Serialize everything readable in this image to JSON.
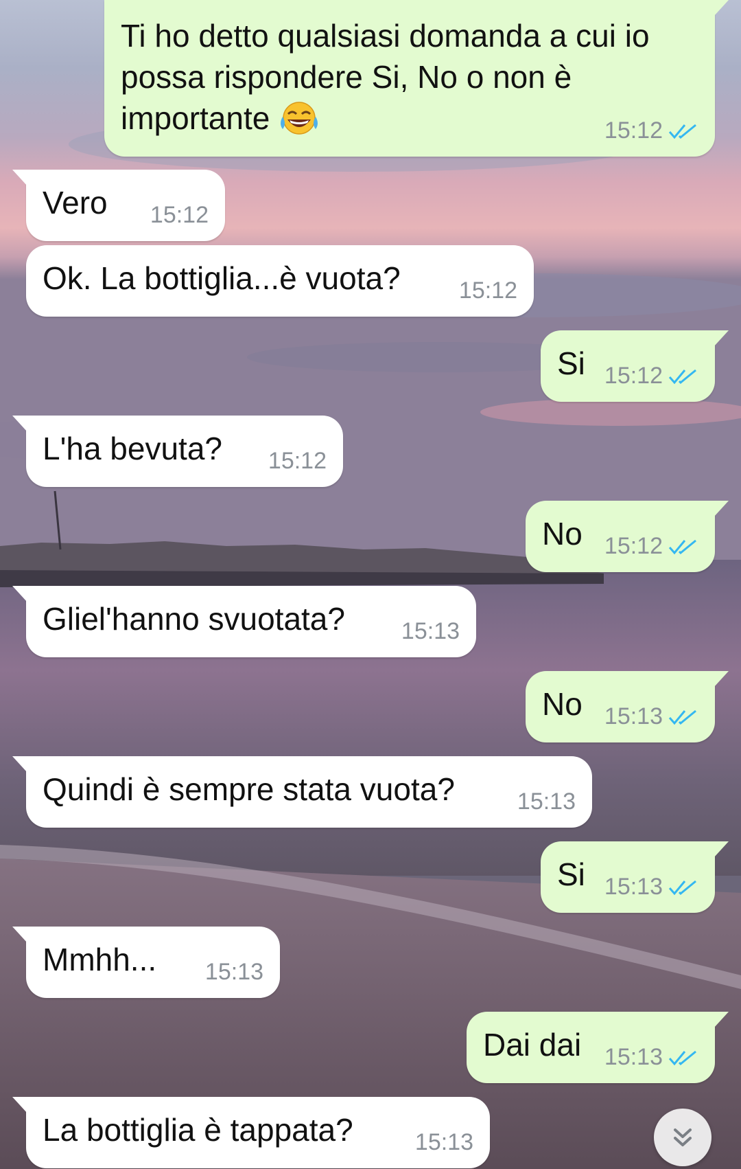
{
  "colors": {
    "incoming_bubble": "#ffffff",
    "outgoing_bubble": "#e3fbd0",
    "timestamp": "#8a9097",
    "read_ticks": "#34b7f1"
  },
  "messages": [
    {
      "direction": "out",
      "text": "Ti ho detto qualsiasi domanda a cui io possa rispondere Si, No o non è importante",
      "emoji": "face-with-tears-of-joy",
      "time": "15:12",
      "status": "read"
    },
    {
      "direction": "in",
      "text": "Vero",
      "time": "15:12"
    },
    {
      "direction": "in",
      "text": "Ok. La bottiglia...è vuota?",
      "time": "15:12"
    },
    {
      "direction": "out",
      "text": "Si",
      "time": "15:12",
      "status": "read"
    },
    {
      "direction": "in",
      "text": "L'ha bevuta?",
      "time": "15:12"
    },
    {
      "direction": "out",
      "text": "No",
      "time": "15:12",
      "status": "read"
    },
    {
      "direction": "in",
      "text": "Gliel'hanno svuotata?",
      "time": "15:13"
    },
    {
      "direction": "out",
      "text": "No",
      "time": "15:13",
      "status": "read"
    },
    {
      "direction": "in",
      "text": "Quindi è sempre stata vuota?",
      "time": "15:13"
    },
    {
      "direction": "out",
      "text": "Si",
      "time": "15:13",
      "status": "read"
    },
    {
      "direction": "in",
      "text": "Mmhh...",
      "time": "15:13"
    },
    {
      "direction": "out",
      "text": "Dai dai",
      "time": "15:13",
      "status": "read"
    },
    {
      "direction": "in",
      "text": "La bottiglia è tappata?",
      "time": "15:13"
    }
  ],
  "scroll_button": {
    "icon": "double-chevron-down-icon"
  }
}
